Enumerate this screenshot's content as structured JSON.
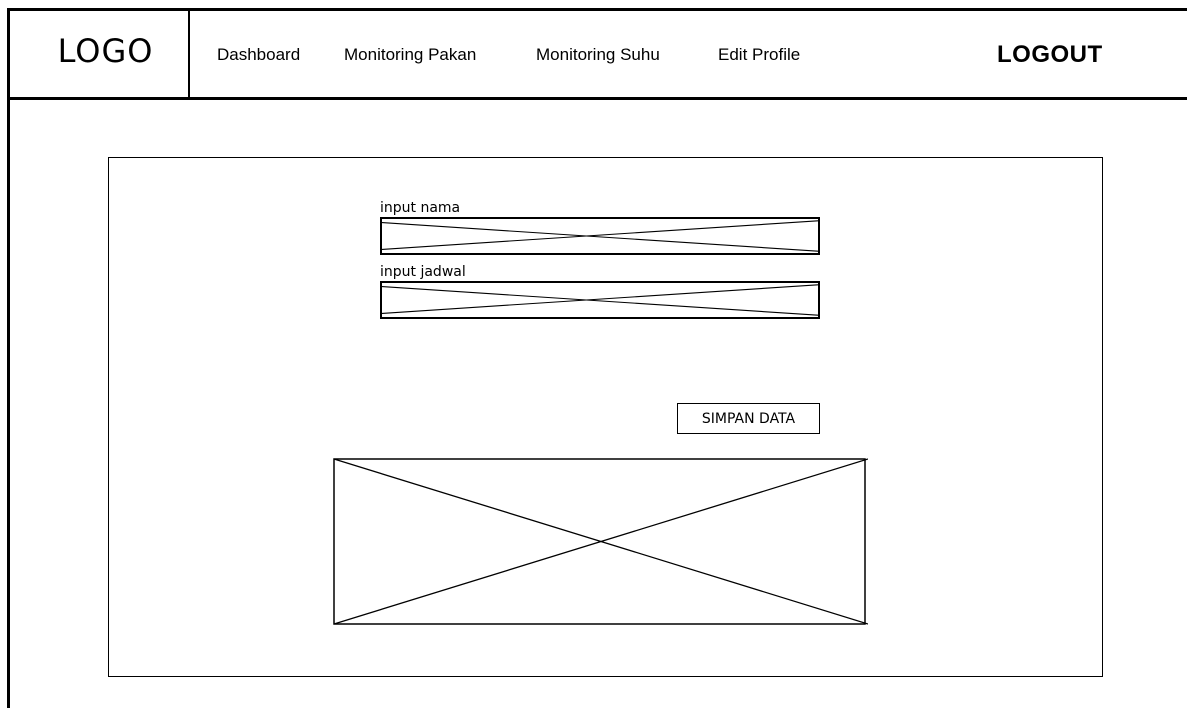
{
  "navbar": {
    "logo": "LOGO",
    "links": [
      {
        "label": "Dashboard"
      },
      {
        "label": "Monitoring Pakan"
      },
      {
        "label": "Monitoring Suhu"
      },
      {
        "label": "Edit Profile"
      }
    ],
    "logout": "LOGOUT"
  },
  "form": {
    "name_label": "input nama",
    "schedule_label": "input jadwal",
    "save_label": "SIMPAN DATA"
  }
}
